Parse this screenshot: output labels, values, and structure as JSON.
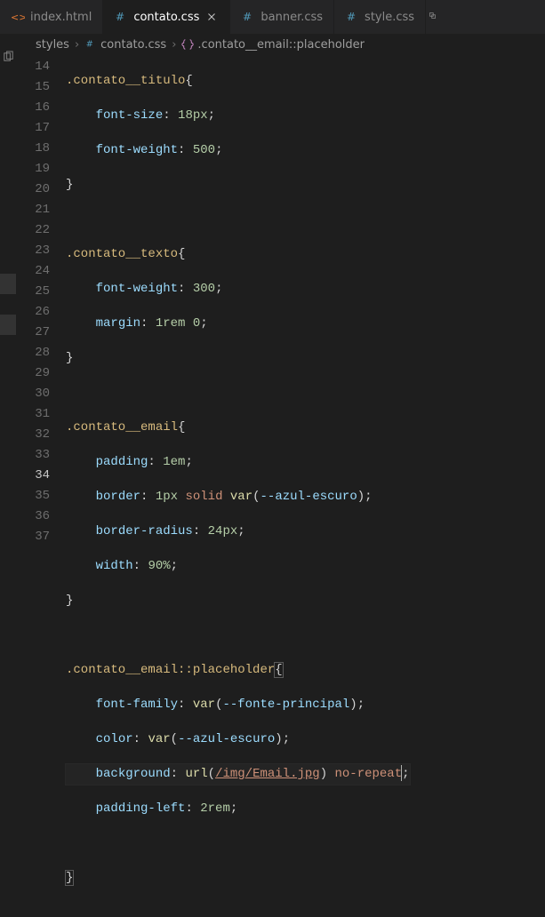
{
  "tabs": [
    {
      "label": "index.html",
      "kind": "html",
      "active": false
    },
    {
      "label": "contato.css",
      "kind": "css",
      "active": true
    },
    {
      "label": "banner.css",
      "kind": "css",
      "active": false
    },
    {
      "label": "style.css",
      "kind": "css",
      "active": false
    }
  ],
  "breadcrumbs": {
    "folder": "styles",
    "file": "contato.css",
    "symbol": ".contato__email::placeholder"
  },
  "lines": {
    "start": 14,
    "end": 37,
    "current": 34
  },
  "code": {
    "l14": {
      "sel": ".contato__titulo",
      "brace": "{"
    },
    "l15": {
      "prop": "font-size",
      "val_num": "18px",
      "end": ";"
    },
    "l16": {
      "prop": "font-weight",
      "val_num": "500",
      "end": ";"
    },
    "l17": {
      "brace": "}"
    },
    "l18": "",
    "l19": {
      "sel": ".contato__texto",
      "brace": "{"
    },
    "l20": {
      "prop": "font-weight",
      "val_num": "300",
      "end": ";"
    },
    "l21": {
      "prop": "margin",
      "val_num": "1rem 0",
      "end": ";"
    },
    "l22": {
      "brace": "}"
    },
    "l23": "",
    "l24": {
      "sel": ".contato__email",
      "brace": "{"
    },
    "l25": {
      "prop": "padding",
      "val_num": "1em",
      "end": ";"
    },
    "l26": {
      "prop": "border",
      "val_num": "1px",
      "kw": "solid",
      "func": "var",
      "arg": "--azul-escuro",
      "end": ";"
    },
    "l27": {
      "prop": "border-radius",
      "val_num": "24px",
      "end": ";"
    },
    "l28": {
      "prop": "width",
      "val_num": "90%",
      "end": ";"
    },
    "l29": {
      "brace": "}"
    },
    "l30": "",
    "l31": {
      "sel": ".contato__email",
      "pseudo": "::placeholder",
      "brace": "{"
    },
    "l32": {
      "prop": "font-family",
      "func": "var",
      "arg": "--fonte-principal",
      "end": ";"
    },
    "l33": {
      "prop": "color",
      "func": "var",
      "arg": "--azul-escuro",
      "end": ";"
    },
    "l34": {
      "prop": "background",
      "func": "url",
      "path": "/img/Email.jpg",
      "kw2": "no-repeat",
      "end": ";"
    },
    "l35": {
      "prop": "padding-left",
      "val_num": "2rem",
      "end": ";"
    },
    "l36": "",
    "l37": {
      "brace": "}"
    }
  }
}
